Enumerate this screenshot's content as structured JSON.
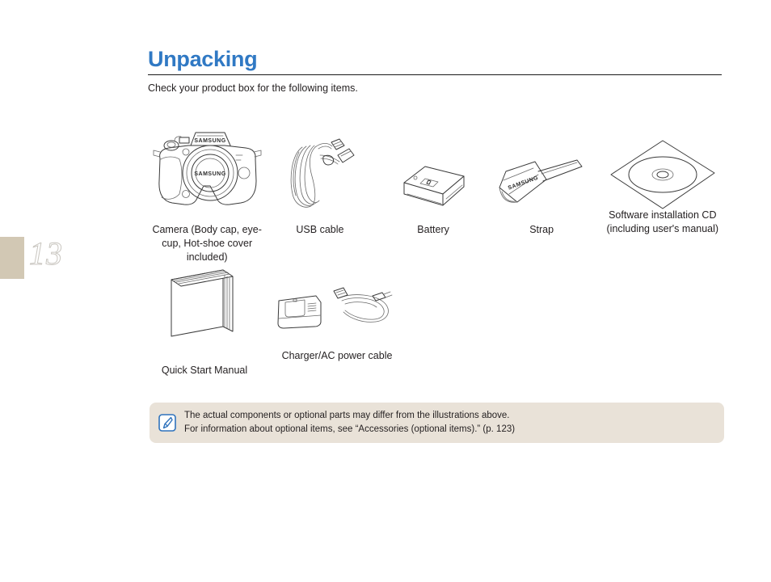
{
  "page": {
    "number": "13"
  },
  "header": {
    "title": "Unpacking",
    "subtitle": "Check your product box for the following items."
  },
  "items_row_one": [
    {
      "id": "camera",
      "icon": "camera-illustration",
      "caption": "Camera (Body cap, eye-cup, Hot-shoe cover included)",
      "brand": "SAMSUNG"
    },
    {
      "id": "usb",
      "icon": "usb-cable-illustration",
      "caption": "USB cable"
    },
    {
      "id": "battery",
      "icon": "battery-illustration",
      "caption": "Battery"
    },
    {
      "id": "strap",
      "icon": "strap-illustration",
      "caption": "Strap",
      "brand": "SAMSUNG"
    },
    {
      "id": "cd",
      "icon": "cd-illustration",
      "caption": "Software installation CD (including user's manual)"
    }
  ],
  "items_row_two": [
    {
      "id": "manual",
      "icon": "manual-book-illustration",
      "caption": "Quick Start Manual"
    },
    {
      "id": "charger",
      "icon": "charger-ac-cable-illustration",
      "caption": "Charger/AC power cable"
    }
  ],
  "note": {
    "icon": "note-pen-icon",
    "line1": "The actual components or optional parts may differ from the illustrations above.",
    "line2": "For information about optional items, see “Accessories (optional items).”  (p. 123)"
  },
  "colors": {
    "title_blue": "#3079c4",
    "note_background": "#e9e2d8",
    "margin_block_tan": "#d2c8b4",
    "page_number_outline": "#c9c6c0",
    "body_text": "#231f20"
  }
}
